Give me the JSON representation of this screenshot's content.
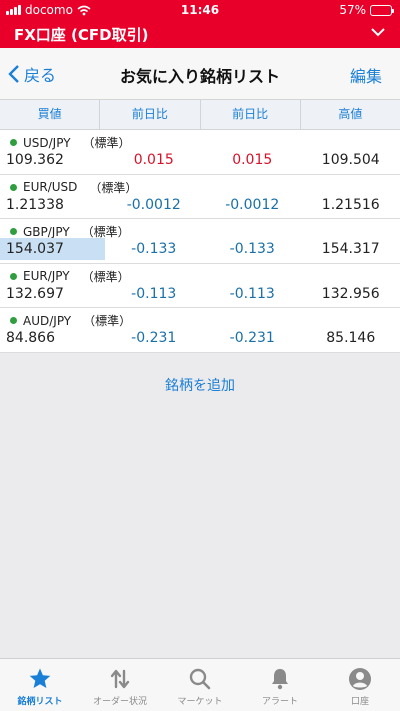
{
  "status": {
    "carrier": "docomo",
    "time": "11:46",
    "battery": "57%",
    "battery_level": 0.57
  },
  "account": {
    "title": "FX口座 (CFD取引)"
  },
  "nav": {
    "back_label": "戻る",
    "title": "お気に入り銘柄リスト",
    "edit_label": "編集"
  },
  "columns": [
    "買値",
    "前日比",
    "前日比",
    "高値"
  ],
  "rows": [
    {
      "symbol": "USD/JPY",
      "tag": "（標準）",
      "bid": "109.362",
      "change1": "0.015",
      "change2": "0.015",
      "high": "109.504"
    },
    {
      "symbol": "EUR/USD",
      "tag": "（標準）",
      "bid": "1.21338",
      "change1": "-0.0012",
      "change2": "-0.0012",
      "high": "1.21516"
    },
    {
      "symbol": "GBP/JPY",
      "tag": "（標準）",
      "bid": "154.037",
      "change1": "-0.133",
      "change2": "-0.133",
      "high": "154.317"
    },
    {
      "symbol": "EUR/JPY",
      "tag": "（標準）",
      "bid": "132.697",
      "change1": "-0.113",
      "change2": "-0.113",
      "high": "132.956"
    },
    {
      "symbol": "AUD/JPY",
      "tag": "（標準）",
      "bid": "84.866",
      "change1": "-0.231",
      "change2": "-0.231",
      "high": "85.146"
    }
  ],
  "add_label": "銘柄を追加",
  "tabs": [
    {
      "label": "銘柄リスト",
      "icon": "star-icon"
    },
    {
      "label": "オーダー状況",
      "icon": "swap-arrows-icon"
    },
    {
      "label": "マーケット",
      "icon": "search-icon"
    },
    {
      "label": "アラート",
      "icon": "bell-icon"
    },
    {
      "label": "口座",
      "icon": "person-icon"
    }
  ],
  "colors": {
    "brand": "#e8002a",
    "link": "#1a7fd6",
    "positive": "#d6132a",
    "negative": "#1a70a8",
    "online_dot": "#2e9e3e"
  }
}
